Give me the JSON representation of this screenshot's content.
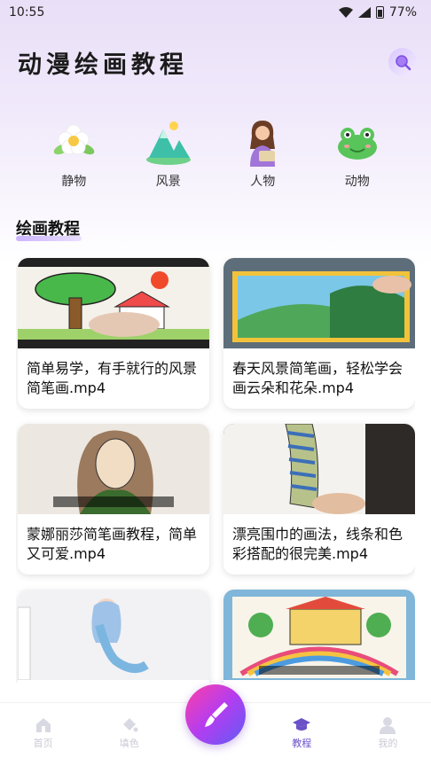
{
  "status": {
    "time": "10:55",
    "battery": "77%"
  },
  "header": {
    "title": "动漫绘画教程"
  },
  "categories": [
    {
      "label": "静物",
      "icon": "flower-icon"
    },
    {
      "label": "风景",
      "icon": "landscape-icon"
    },
    {
      "label": "人物",
      "icon": "person-icon"
    },
    {
      "label": "动物",
      "icon": "frog-icon"
    }
  ],
  "section": {
    "title": "绘画教程"
  },
  "videos": [
    {
      "title": "简单易学，有手就行的风景简笔画.mp4"
    },
    {
      "title": "春天风景简笔画，轻松学会画云朵和花朵.mp4"
    },
    {
      "title": "蒙娜丽莎简笔画教程，简单又可爱.mp4"
    },
    {
      "title": "漂亮围巾的画法，线条和色彩搭配的很完美.mp4"
    },
    {
      "title": ""
    },
    {
      "title": ""
    }
  ],
  "nav": {
    "items": [
      {
        "label": "首页",
        "icon": "home-icon"
      },
      {
        "label": "填色",
        "icon": "paint-bucket-icon"
      },
      {
        "label": "",
        "icon": "brush-icon"
      },
      {
        "label": "教程",
        "icon": "graduation-cap-icon"
      },
      {
        "label": "我的",
        "icon": "user-icon"
      }
    ]
  },
  "colors": {
    "accent": "#6b50c8",
    "fab_start": "#ff3fa4",
    "fab_end": "#5e5cf5",
    "background_top": "#e9dff7"
  }
}
